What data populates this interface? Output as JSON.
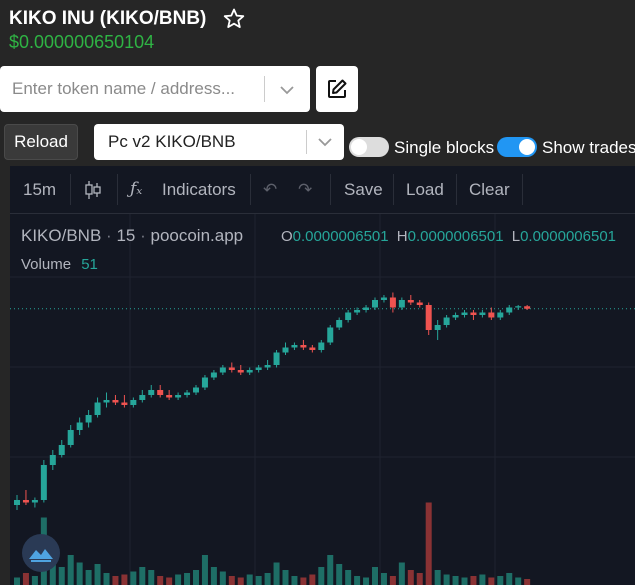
{
  "header": {
    "title": "KIKO INU (KIKO/BNB)",
    "price": "$0.000000650104"
  },
  "search": {
    "placeholder": "Enter token name / address..."
  },
  "controls": {
    "reload_label": "Reload",
    "pair_selected": "Pc v2 KIKO/BNB",
    "single_blocks_label": "Single blocks",
    "single_blocks_on": false,
    "show_trades_label": "Show trades",
    "show_trades_on": true
  },
  "chart_toolbar": {
    "interval": "15m",
    "indicators": "Indicators",
    "save": "Save",
    "load": "Load",
    "clear": "Clear"
  },
  "chart_legend": {
    "symbol": "KIKO/BNB",
    "interval": "15",
    "source": "poocoin.app",
    "o_label": "O",
    "o_value": "0.0000006501",
    "h_label": "H",
    "h_value": "0.0000006501",
    "l_label": "L",
    "l_value": "0.0000006501",
    "volume_label": "Volume",
    "volume_value": "51"
  },
  "colors": {
    "up": "#26a69a",
    "down": "#ef5350",
    "vol_up": "#1e6e66",
    "vol_down": "#8a3234",
    "toggle_on": "#2196f3",
    "toggle_off": "#dddddd",
    "price_green": "#2fb344"
  },
  "chart_data": {
    "type": "candlestick",
    "candles": [
      [
        0.14,
        0.18,
        0.12,
        0.16
      ],
      [
        0.16,
        0.2,
        0.14,
        0.15
      ],
      [
        0.15,
        0.17,
        0.13,
        0.16
      ],
      [
        0.16,
        0.32,
        0.15,
        0.3
      ],
      [
        0.3,
        0.36,
        0.28,
        0.34
      ],
      [
        0.34,
        0.4,
        0.33,
        0.38
      ],
      [
        0.38,
        0.46,
        0.37,
        0.44
      ],
      [
        0.44,
        0.49,
        0.42,
        0.47
      ],
      [
        0.47,
        0.52,
        0.45,
        0.5
      ],
      [
        0.5,
        0.57,
        0.49,
        0.55
      ],
      [
        0.55,
        0.59,
        0.53,
        0.56
      ],
      [
        0.56,
        0.58,
        0.54,
        0.55
      ],
      [
        0.55,
        0.58,
        0.53,
        0.54
      ],
      [
        0.54,
        0.57,
        0.53,
        0.56
      ],
      [
        0.56,
        0.6,
        0.55,
        0.58
      ],
      [
        0.58,
        0.62,
        0.57,
        0.6
      ],
      [
        0.6,
        0.62,
        0.57,
        0.58
      ],
      [
        0.58,
        0.6,
        0.56,
        0.57
      ],
      [
        0.57,
        0.59,
        0.56,
        0.58
      ],
      [
        0.58,
        0.6,
        0.57,
        0.59
      ],
      [
        0.59,
        0.62,
        0.58,
        0.61
      ],
      [
        0.61,
        0.66,
        0.6,
        0.65
      ],
      [
        0.65,
        0.68,
        0.64,
        0.67
      ],
      [
        0.67,
        0.7,
        0.66,
        0.69
      ],
      [
        0.69,
        0.71,
        0.67,
        0.68
      ],
      [
        0.68,
        0.7,
        0.66,
        0.67
      ],
      [
        0.67,
        0.69,
        0.66,
        0.68
      ],
      [
        0.68,
        0.7,
        0.67,
        0.69
      ],
      [
        0.69,
        0.72,
        0.68,
        0.7
      ],
      [
        0.7,
        0.76,
        0.69,
        0.75
      ],
      [
        0.75,
        0.79,
        0.74,
        0.77
      ],
      [
        0.77,
        0.79,
        0.76,
        0.78
      ],
      [
        0.78,
        0.8,
        0.76,
        0.77
      ],
      [
        0.77,
        0.78,
        0.75,
        0.76
      ],
      [
        0.76,
        0.8,
        0.75,
        0.79
      ],
      [
        0.79,
        0.86,
        0.78,
        0.85
      ],
      [
        0.85,
        0.89,
        0.84,
        0.88
      ],
      [
        0.88,
        0.92,
        0.87,
        0.91
      ],
      [
        0.91,
        0.93,
        0.9,
        0.92
      ],
      [
        0.92,
        0.94,
        0.91,
        0.93
      ],
      [
        0.93,
        0.97,
        0.92,
        0.96
      ],
      [
        0.96,
        0.98,
        0.95,
        0.97
      ],
      [
        0.97,
        0.99,
        0.91,
        0.93
      ],
      [
        0.93,
        0.97,
        0.92,
        0.96
      ],
      [
        0.96,
        0.98,
        0.94,
        0.95
      ],
      [
        0.95,
        0.96,
        0.93,
        0.94
      ],
      [
        0.94,
        0.95,
        0.82,
        0.84
      ],
      [
        0.84,
        0.88,
        0.8,
        0.86
      ],
      [
        0.86,
        0.9,
        0.85,
        0.89
      ],
      [
        0.89,
        0.91,
        0.88,
        0.9
      ],
      [
        0.9,
        0.92,
        0.89,
        0.91
      ],
      [
        0.91,
        0.92,
        0.88,
        0.9
      ],
      [
        0.9,
        0.92,
        0.89,
        0.91
      ],
      [
        0.91,
        0.93,
        0.88,
        0.89
      ],
      [
        0.89,
        0.92,
        0.88,
        0.91
      ],
      [
        0.91,
        0.94,
        0.9,
        0.93
      ],
      [
        0.93,
        0.94,
        0.92,
        0.935
      ],
      [
        0.935,
        0.94,
        0.92,
        0.925
      ]
    ],
    "volumes": [
      0.05,
      0.08,
      0.06,
      0.45,
      0.18,
      0.12,
      0.2,
      0.15,
      0.1,
      0.14,
      0.08,
      0.06,
      0.07,
      0.09,
      0.12,
      0.1,
      0.06,
      0.05,
      0.07,
      0.08,
      0.1,
      0.2,
      0.12,
      0.09,
      0.06,
      0.05,
      0.07,
      0.06,
      0.08,
      0.15,
      0.1,
      0.06,
      0.05,
      0.07,
      0.12,
      0.2,
      0.14,
      0.1,
      0.06,
      0.05,
      0.12,
      0.08,
      0.06,
      0.15,
      0.1,
      0.08,
      0.55,
      0.1,
      0.07,
      0.06,
      0.05,
      0.06,
      0.07,
      0.05,
      0.06,
      0.08,
      0.05,
      0.04
    ],
    "last_price": 6.501e-07
  }
}
